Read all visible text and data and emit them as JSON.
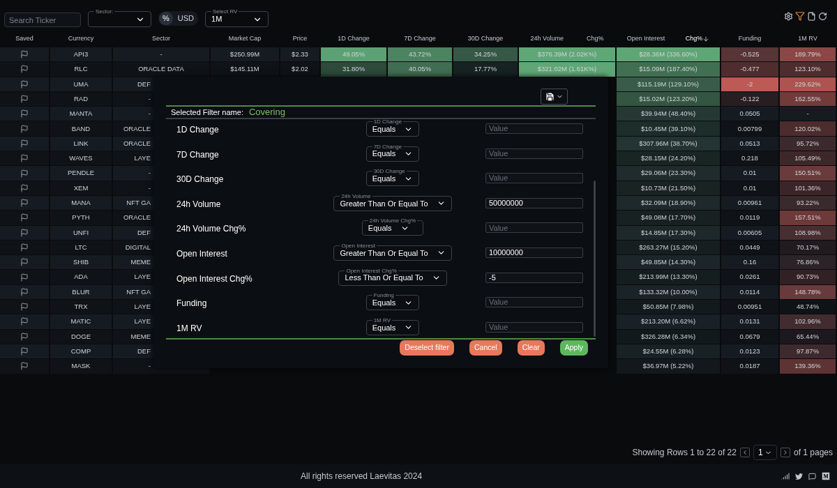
{
  "toolbar": {
    "search": {
      "placeholder": "Search Ticker"
    },
    "sector": {
      "label": "Sector:"
    },
    "units": [
      {
        "label": "%",
        "selected": true
      },
      {
        "label": "USD",
        "selected": false
      }
    ],
    "rv": {
      "label": "Select RV",
      "value": "1M"
    }
  },
  "table": {
    "columns": [
      {
        "label": "Saved"
      },
      {
        "label": "Currency"
      },
      {
        "label": "Sector"
      },
      {
        "label": "Market Cap"
      },
      {
        "label": "Price"
      },
      {
        "label": "1D Change"
      },
      {
        "label": "7D Change"
      },
      {
        "label": "30D Change"
      },
      {
        "label": "24h Volume",
        "sub": "Chg%",
        "sorted": false
      },
      {
        "label": "Open Interest",
        "sub": "Chg%",
        "sorted": true
      },
      {
        "label": "Funding"
      },
      {
        "label": "1M RV"
      }
    ],
    "rows": [
      {
        "currency": "API3",
        "sector": "-",
        "market_cap": "$250.99M",
        "price": "$2.33",
        "change_1d": "49.05%",
        "change_7d": "43.72%",
        "change_30d": "34.25%",
        "volume_24h": "$376.39M (2.02K%)",
        "open_interest": "$28.36M (336.60%)",
        "funding": "-0.525",
        "rv_1m": "189.79%"
      },
      {
        "currency": "RLC",
        "sector": "ORACLE DATA",
        "market_cap": "$145.11M",
        "price": "$2.02",
        "change_1d": "31.80%",
        "change_7d": "40.05%",
        "change_30d": "17.77%",
        "volume_24h": "$321.02M (1.61K%)",
        "open_interest": "$15.09M (187.40%)",
        "funding": "-0.477",
        "rv_1m": "123.10%"
      },
      {
        "currency": "UMA",
        "sector": "DEF",
        "open_interest": "$115.19M (129.10%)",
        "funding": "-2",
        "rv_1m": "229.62%"
      },
      {
        "currency": "RAD",
        "sector": "-",
        "open_interest": "$15.02M (123.20%)",
        "funding": "-0.122",
        "rv_1m": "162.55%"
      },
      {
        "currency": "MANTA",
        "sector": "-",
        "open_interest": "$39.94M (48.40%)",
        "funding": "0.0505",
        "rv_1m": "-"
      },
      {
        "currency": "BAND",
        "sector": "ORACLE",
        "open_interest": "$10.45M (39.10%)",
        "funding": "0.00799",
        "rv_1m": "120.02%"
      },
      {
        "currency": "LINK",
        "sector": "ORACLE",
        "open_interest": "$307.96M (38.70%)",
        "funding": "0.0513",
        "rv_1m": "95.72%"
      },
      {
        "currency": "WAVES",
        "sector": "LAYE",
        "open_interest": "$28.15M (24.20%)",
        "funding": "0.218",
        "rv_1m": "105.49%"
      },
      {
        "currency": "PENDLE",
        "sector": "-",
        "open_interest": "$29.06M (23.30%)",
        "funding": "0.01",
        "rv_1m": "150.51%"
      },
      {
        "currency": "XEM",
        "sector": "-",
        "open_interest": "$10.73M (21.50%)",
        "funding": "0.01",
        "rv_1m": "101.36%"
      },
      {
        "currency": "MANA",
        "sector": "NFT GA",
        "open_interest": "$32.09M (18.90%)",
        "funding": "0.00961",
        "rv_1m": "93.22%"
      },
      {
        "currency": "PYTH",
        "sector": "ORACLE",
        "open_interest": "$49.08M (17.70%)",
        "funding": "0.0119",
        "rv_1m": "157.51%"
      },
      {
        "currency": "UNFI",
        "sector": "DEF",
        "open_interest": "$14.85M (17.30%)",
        "funding": "0.00605",
        "rv_1m": "108.98%"
      },
      {
        "currency": "LTC",
        "sector": "DIGITAL",
        "open_interest": "$263.27M (15.20%)",
        "funding": "0.0449",
        "rv_1m": "70.17%"
      },
      {
        "currency": "SHIB",
        "sector": "MEME",
        "open_interest": "$49.85M (14.30%)",
        "funding": "0.16",
        "rv_1m": "76.86%"
      },
      {
        "currency": "ADA",
        "sector": "LAYE",
        "open_interest": "$213.99M (13.30%)",
        "funding": "0.0261",
        "rv_1m": "90.73%"
      },
      {
        "currency": "BLUR",
        "sector": "NFT GA",
        "open_interest": "$133.32M (10.00%)",
        "funding": "0.0114",
        "rv_1m": "148.78%"
      },
      {
        "currency": "TRX",
        "sector": "LAYE",
        "open_interest": "$50.85M (7.98%)",
        "funding": "0.00951",
        "rv_1m": "48.74%"
      },
      {
        "currency": "MATIC",
        "sector": "LAYE",
        "open_interest": "$213.20M (6.62%)",
        "funding": "0.0131",
        "rv_1m": "102.96%"
      },
      {
        "currency": "DOGE",
        "sector": "MEME",
        "open_interest": "$326.28M (6.34%)",
        "funding": "0.0679",
        "rv_1m": "65.44%"
      },
      {
        "currency": "COMP",
        "sector": "DEF",
        "open_interest": "$24.55M (6.28%)",
        "funding": "0.0123",
        "rv_1m": "97.87%"
      },
      {
        "currency": "MASK",
        "sector": "-",
        "open_interest": "$36.97M (5.22%)",
        "funding": "0.0187",
        "rv_1m": "139.36%"
      }
    ]
  },
  "filter_dialog": {
    "name_label": "Selected Filter name:",
    "name": "Covering",
    "filters": [
      {
        "label": "1D Change",
        "operator_label": "1D Change",
        "operator": "Equals",
        "placeholder": "Value"
      },
      {
        "label": "7D Change",
        "operator_label": "7D Change",
        "operator": "Equals",
        "placeholder": "Value"
      },
      {
        "label": "30D Change",
        "operator_label": "30D Change",
        "operator": "Equals",
        "placeholder": "Value"
      },
      {
        "label": "24h Volume",
        "operator_label": "24h Volume",
        "operator": "Greater Than Or Equal To",
        "value": "50000000"
      },
      {
        "label": "24h Volume Chg%",
        "operator_label": "24h Volume Chg%",
        "operator": "Equals",
        "placeholder": "Value"
      },
      {
        "label": "Open Interest",
        "operator_label": "Open Interest",
        "operator": "Greater Than Or Equal To",
        "value": "10000000"
      },
      {
        "label": "Open Interest Chg%",
        "operator_label": "Open Interest Chg%",
        "operator": "Less Than Or Equal To",
        "value": "-5"
      },
      {
        "label": "Funding",
        "operator_label": "Funding",
        "operator": "Equals",
        "placeholder": "Value"
      },
      {
        "label": "1M RV",
        "operator_label": "1M RV",
        "operator": "Equals",
        "placeholder": "Value"
      }
    ],
    "buttons": [
      {
        "label": "Deselect filter",
        "kind": "secondary"
      },
      {
        "label": "Cancel",
        "kind": "secondary"
      },
      {
        "label": "Clear",
        "kind": "secondary"
      },
      {
        "label": "Apply",
        "kind": "primary"
      }
    ]
  },
  "pagination": {
    "summary": "Showing Rows 1 to 22 of 22",
    "page": "1",
    "total": "of 1 pages"
  },
  "footer": {
    "copyright": "All rights reserved Laevitas 2024"
  }
}
